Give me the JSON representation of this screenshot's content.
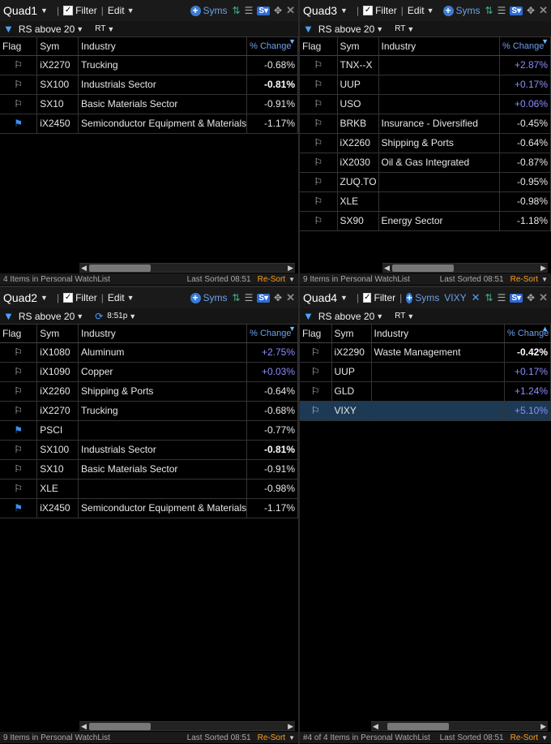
{
  "quads": [
    {
      "id": "q1",
      "name": "Quad1",
      "filter_label": "Filter",
      "edit_label": "Edit",
      "syms_label": "Syms",
      "screen": "RS above 20",
      "mode": "RT",
      "cols": {
        "flag": "Flag",
        "sym": "Sym",
        "industry": "Industry",
        "chg": "% Change"
      },
      "rows": [
        {
          "flag": "white",
          "sym": "iX2270",
          "industry": "Trucking",
          "chg": "-0.68%",
          "dir": "neg",
          "bold": false
        },
        {
          "flag": "white",
          "sym": "SX100",
          "industry": "Industrials Sector",
          "chg": "-0.81%",
          "dir": "neg",
          "bold": true
        },
        {
          "flag": "white",
          "sym": "SX10",
          "industry": "Basic Materials Sector",
          "chg": "-0.91%",
          "dir": "neg",
          "bold": false
        },
        {
          "flag": "blue",
          "sym": "iX2450",
          "industry": "Semiconductor Equipment & Materials",
          "chg": "-1.17%",
          "dir": "neg",
          "bold": false
        }
      ],
      "status_count": "4 Items in Personal WatchList",
      "last_sorted": "Last Sorted 08:51",
      "resort": "Re-Sort"
    },
    {
      "id": "q3",
      "name": "Quad3",
      "filter_label": "Filter",
      "edit_label": "Edit",
      "syms_label": "Syms",
      "screen": "RS above 20",
      "mode": "RT",
      "cols": {
        "flag": "Flag",
        "sym": "Sym",
        "industry": "Industry",
        "chg": "% Change"
      },
      "rows": [
        {
          "flag": "white",
          "sym": "TNX--X",
          "industry": "",
          "chg": "+2.87%",
          "dir": "pos",
          "bold": false
        },
        {
          "flag": "white",
          "sym": "UUP",
          "industry": "",
          "chg": "+0.17%",
          "dir": "pos",
          "bold": false
        },
        {
          "flag": "white",
          "sym": "USO",
          "industry": "",
          "chg": "+0.06%",
          "dir": "pos",
          "bold": false
        },
        {
          "flag": "white",
          "sym": "BRKB",
          "industry": "Insurance - Diversified",
          "chg": "-0.45%",
          "dir": "neg",
          "bold": false
        },
        {
          "flag": "white",
          "sym": "iX2260",
          "industry": "Shipping & Ports",
          "chg": "-0.64%",
          "dir": "neg",
          "bold": false
        },
        {
          "flag": "white",
          "sym": "iX2030",
          "industry": "Oil & Gas Integrated",
          "chg": "-0.87%",
          "dir": "neg",
          "bold": false
        },
        {
          "flag": "white",
          "sym": "ZUQ.TO",
          "industry": "",
          "chg": "-0.95%",
          "dir": "neg",
          "bold": false
        },
        {
          "flag": "white",
          "sym": "XLE",
          "industry": "",
          "chg": "-0.98%",
          "dir": "neg",
          "bold": false
        },
        {
          "flag": "white",
          "sym": "SX90",
          "industry": "Energy Sector",
          "chg": "-1.18%",
          "dir": "neg",
          "bold": false
        }
      ],
      "status_count": "9 Items in Personal WatchList",
      "last_sorted": "Last Sorted 08:51",
      "resort": "Re-Sort"
    },
    {
      "id": "q2",
      "name": "Quad2",
      "filter_label": "Filter",
      "edit_label": "Edit",
      "syms_label": "Syms",
      "screen": "RS above 20",
      "mode": "8:51p",
      "cols": {
        "flag": "Flag",
        "sym": "Sym",
        "industry": "Industry",
        "chg": "% Change"
      },
      "rows": [
        {
          "flag": "white",
          "sym": "iX1080",
          "industry": "Aluminum",
          "chg": "+2.75%",
          "dir": "pos",
          "bold": false
        },
        {
          "flag": "white",
          "sym": "iX1090",
          "industry": "Copper",
          "chg": "+0.03%",
          "dir": "pos",
          "bold": false
        },
        {
          "flag": "white",
          "sym": "iX2260",
          "industry": "Shipping & Ports",
          "chg": "-0.64%",
          "dir": "neg",
          "bold": false
        },
        {
          "flag": "white",
          "sym": "iX2270",
          "industry": "Trucking",
          "chg": "-0.68%",
          "dir": "neg",
          "bold": false
        },
        {
          "flag": "blue",
          "sym": "PSCI",
          "industry": "",
          "chg": "-0.77%",
          "dir": "neg",
          "bold": false
        },
        {
          "flag": "white",
          "sym": "SX100",
          "industry": "Industrials Sector",
          "chg": "-0.81%",
          "dir": "neg",
          "bold": true
        },
        {
          "flag": "white",
          "sym": "SX10",
          "industry": "Basic Materials Sector",
          "chg": "-0.91%",
          "dir": "neg",
          "bold": false
        },
        {
          "flag": "white",
          "sym": "XLE",
          "industry": "",
          "chg": "-0.98%",
          "dir": "neg",
          "bold": false
        },
        {
          "flag": "blue",
          "sym": "iX2450",
          "industry": "Semiconductor Equipment & Materials",
          "chg": "-1.17%",
          "dir": "neg",
          "bold": false
        }
      ],
      "status_count": "9 Items in Personal WatchList",
      "last_sorted": "Last Sorted 08:51",
      "resort": "Re-Sort"
    },
    {
      "id": "q4",
      "name": "Quad4",
      "filter_label": "Filter",
      "edit_label": "",
      "syms_label": "Syms",
      "extra_sym": "VIXY",
      "screen": "RS above 20",
      "mode": "RT",
      "cols": {
        "flag": "Flag",
        "sym": "Sym",
        "industry": "Industry",
        "chg": "% Change"
      },
      "rows": [
        {
          "flag": "white",
          "sym": "iX2290",
          "industry": "Waste Management",
          "chg": "-0.42%",
          "dir": "neg",
          "bold": true
        },
        {
          "flag": "white",
          "sym": "UUP",
          "industry": "",
          "chg": "+0.17%",
          "dir": "pos",
          "bold": false
        },
        {
          "flag": "white",
          "sym": "GLD",
          "industry": "",
          "chg": "+1.24%",
          "dir": "pos",
          "bold": false
        },
        {
          "flag": "white",
          "sym": "VIXY",
          "industry": "",
          "chg": "+5.10%",
          "dir": "pos",
          "bold": false,
          "selected": true
        }
      ],
      "status_count": "#4 of 4 Items in Personal WatchList",
      "last_sorted": "Last Sorted 08:51",
      "resort": "Re-Sort"
    }
  ],
  "colors": {
    "accent": "#4aa3ff",
    "positive": "#8c8cff",
    "resort": "#ff9f1a",
    "selected_row": "#1d3a55"
  }
}
